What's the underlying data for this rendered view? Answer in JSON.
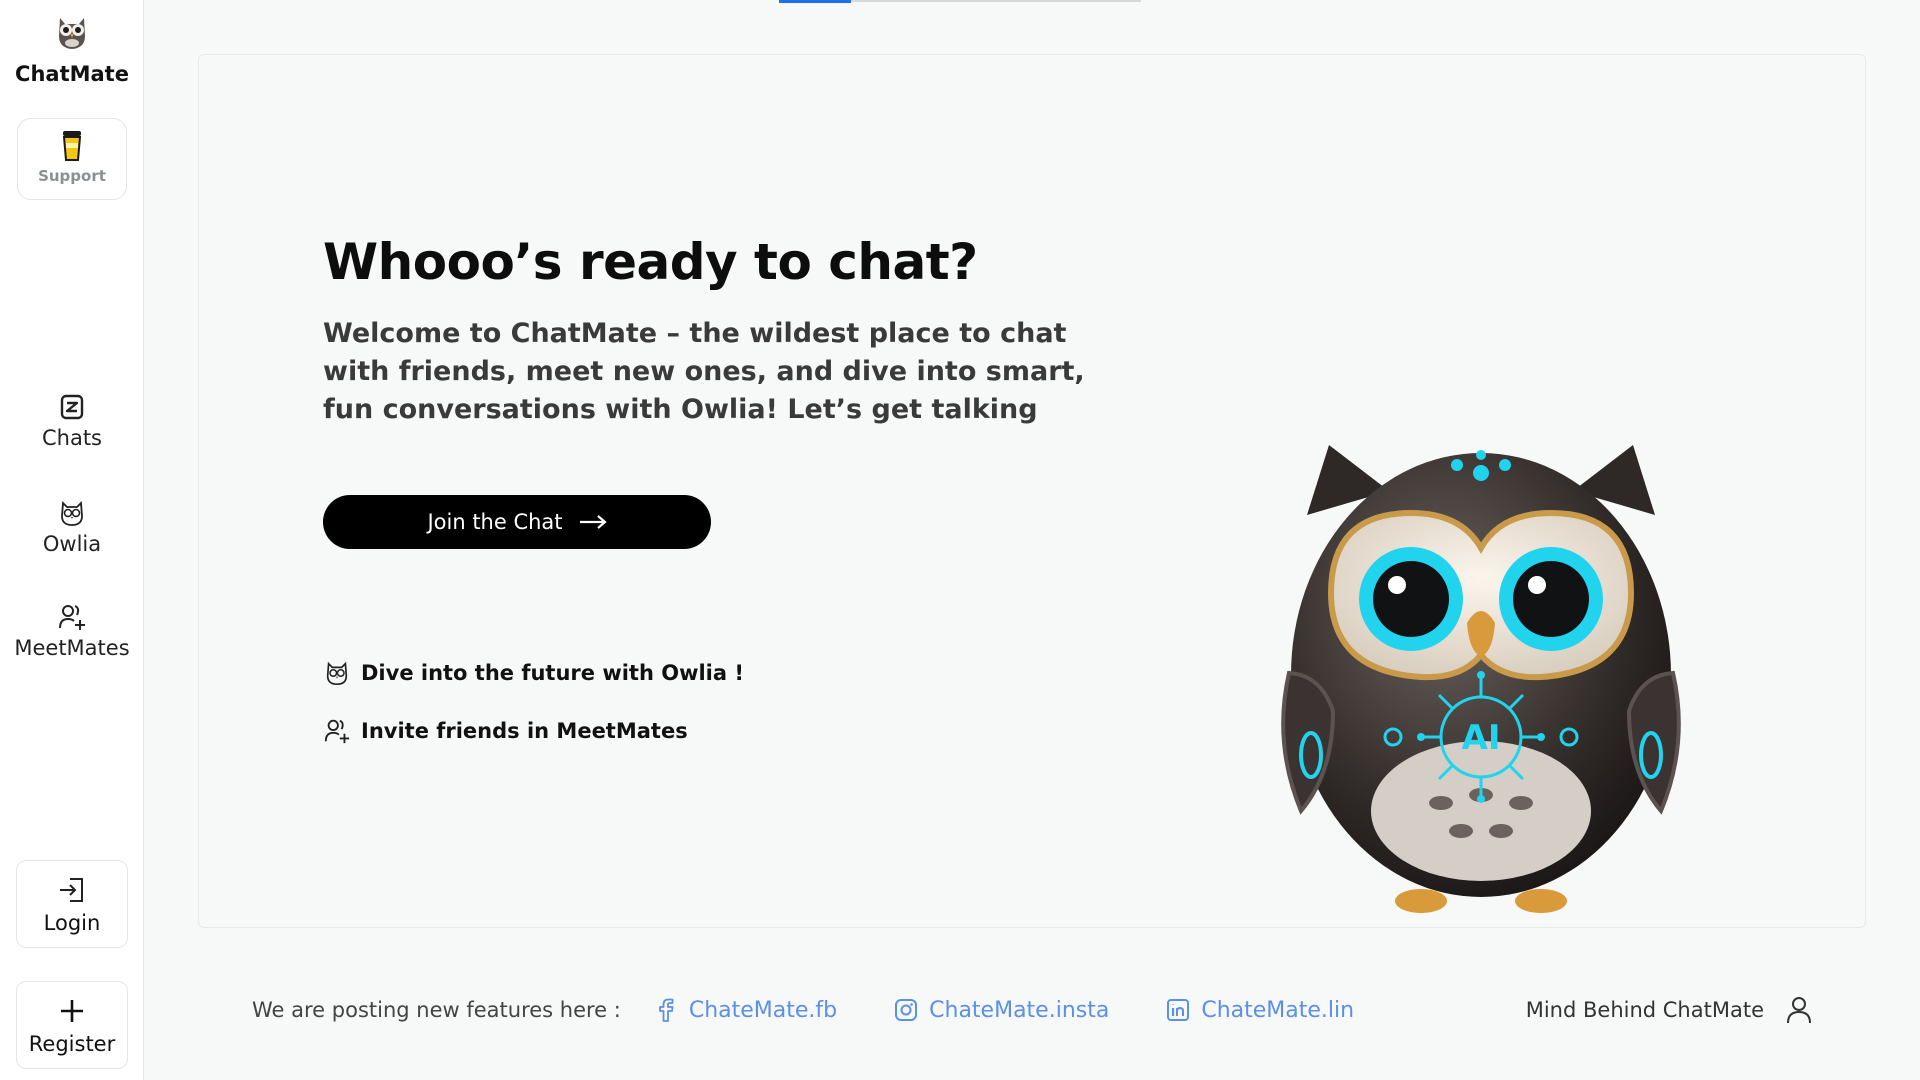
{
  "brand": {
    "name": "ChatMate",
    "logo_icon": "owl-logo-icon"
  },
  "sidebar": {
    "support_label": "Support",
    "items": [
      {
        "label": "Chats",
        "icon": "chats-icon"
      },
      {
        "label": "Owlia",
        "icon": "owl-icon"
      },
      {
        "label": "MeetMates",
        "icon": "add-friend-icon"
      }
    ],
    "login_label": "Login",
    "register_label": "Register"
  },
  "hero": {
    "title": "Whooo’s ready to chat?",
    "subtitle": "Welcome to ChatMate – the wildest place to chat with friends, meet new ones, and dive into smart, fun conversations with Owlia! Let’s get talking",
    "cta_label": "Join the Chat",
    "features": [
      {
        "text": "Dive into the future with Owlia !",
        "icon": "owl-icon"
      },
      {
        "text": "Invite friends in MeetMates",
        "icon": "add-friend-icon"
      }
    ],
    "mascot_badge": "AI"
  },
  "footer": {
    "note": "We are posting new features here :",
    "links": [
      {
        "label": "ChateMate.fb",
        "icon": "facebook-icon"
      },
      {
        "label": "ChateMate.insta",
        "icon": "instagram-icon"
      },
      {
        "label": "ChateMate.lin",
        "icon": "linkedin-icon"
      }
    ],
    "mind_label": "Mind Behind ChatMate"
  },
  "colors": {
    "accent": "#1d6ff0",
    "link": "#5b8fe8",
    "button_bg": "#000000",
    "owl_glow": "#22d3ee"
  },
  "progress": {
    "fraction": 0.2
  }
}
